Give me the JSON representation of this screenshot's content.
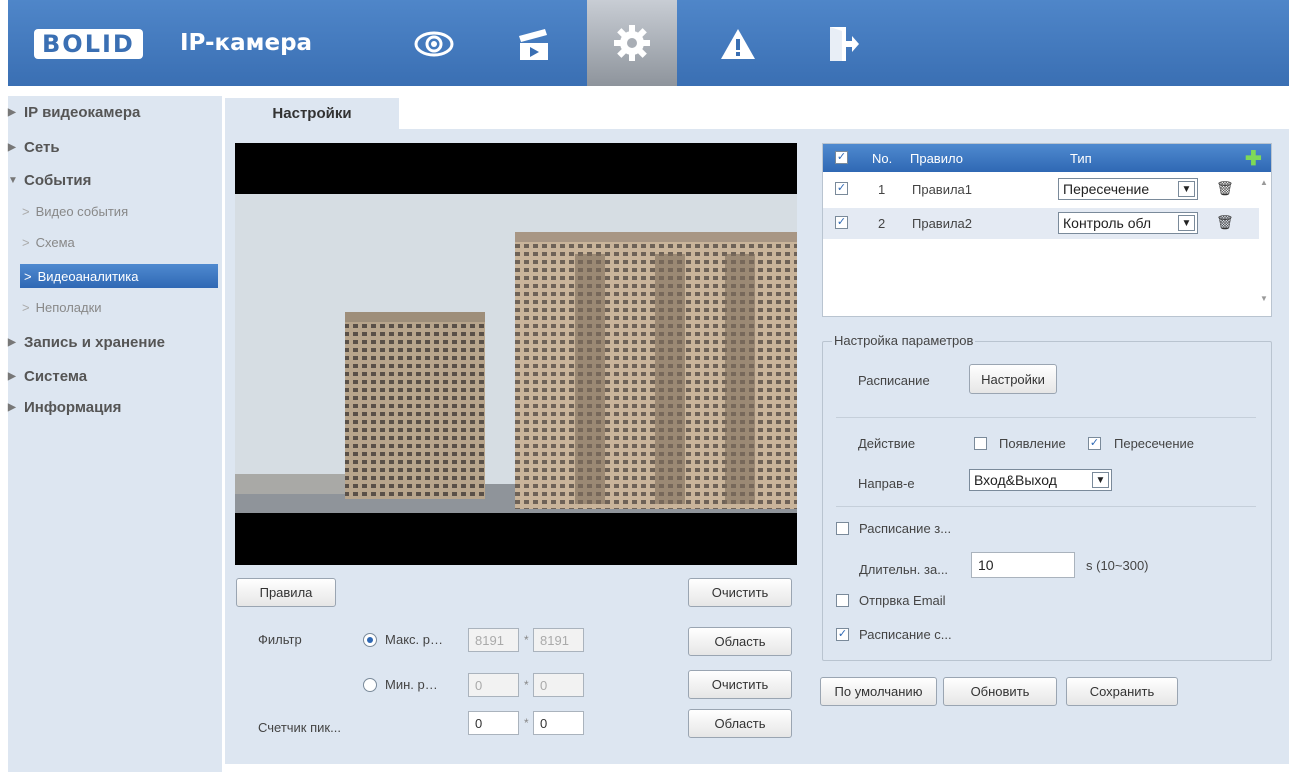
{
  "header": {
    "logo": "BOLID",
    "title": "IP-камера",
    "nav_icons": [
      "eye-icon",
      "clapper-icon",
      "gear-icon",
      "warning-icon",
      "exit-icon"
    ],
    "active_icon": "gear-icon"
  },
  "sidebar": {
    "items": [
      {
        "label": "IP видеокамера",
        "expanded": false
      },
      {
        "label": "Сеть",
        "expanded": false
      },
      {
        "label": "События",
        "expanded": true
      },
      {
        "label": "Запись и хранение",
        "expanded": false
      },
      {
        "label": "Система",
        "expanded": false
      },
      {
        "label": "Информация",
        "expanded": false
      }
    ],
    "sub_items": [
      "Видео события",
      "Схема",
      "Видеоаналитика",
      "Неполадки"
    ],
    "active_sub_item": "Видеоаналитика"
  },
  "tab": {
    "label": "Настройки"
  },
  "video_controls": {
    "rules_button": "Правила",
    "clear_button_1": "Очистить",
    "filter_label": "Фильтр",
    "max_label": "Макс. р…",
    "min_label": "Мин. р…",
    "max_w": "8191",
    "max_h": "8191",
    "min_w": "0",
    "min_h": "0",
    "area_button_1": "Область",
    "clear_button_2": "Очистить",
    "pixel_counter_label": "Счетчик пик...",
    "pixel_w": "0",
    "pixel_h": "0",
    "area_button_2": "Область",
    "star": "*",
    "selected_filter": "max"
  },
  "rules_table": {
    "headers": {
      "no": "No.",
      "rule": "Правило",
      "type": "Тип"
    },
    "add_icon": "plus-icon",
    "rows": [
      {
        "no": "1",
        "name": "Правила1",
        "type": "Пересечение",
        "checked": true
      },
      {
        "no": "2",
        "name": "Правила2",
        "type": "Контроль обл",
        "checked": true
      }
    ]
  },
  "params": {
    "title": "Настройка параметров",
    "schedule_label": "Расписание",
    "schedule_button": "Настройки",
    "action_label": "Действие",
    "action_appear": "Появление",
    "action_appear_checked": false,
    "action_cross": "Пересечение",
    "action_cross_checked": true,
    "direction_label": "Направ-е",
    "direction_value": "Вход&Выход",
    "record_schedule_label": "Расписание з...",
    "record_schedule_checked": false,
    "duration_label": "Длительн. за...",
    "duration_value": "10",
    "duration_range": "s (10~300)",
    "email_label": "Отпрвка Email",
    "email_checked": false,
    "snapshot_label": "Расписание с...",
    "snapshot_checked": true
  },
  "footer_buttons": {
    "default": "По умолчанию",
    "refresh": "Обновить",
    "save": "Сохранить"
  },
  "colors": {
    "header": "#3a6fb3",
    "panel": "#dde6f1",
    "accent": "#2f68b4"
  }
}
